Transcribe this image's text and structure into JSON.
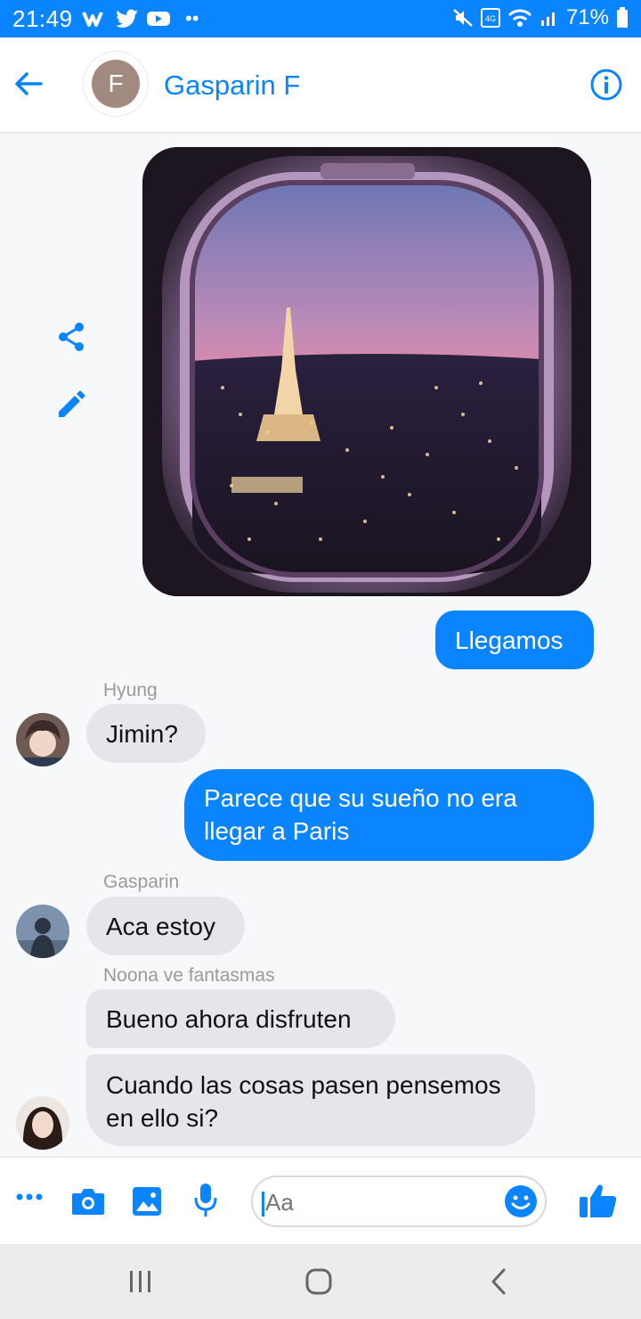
{
  "status": {
    "time": "21:49",
    "battery": "71%",
    "colors": {
      "bar": "#0a84ff"
    }
  },
  "header": {
    "avatar_letter": "F",
    "contact_name": "Gasparin F"
  },
  "messages": [
    {
      "type": "image",
      "direction": "out",
      "content": "airplane-window-eiffel-tower-photo"
    },
    {
      "type": "text",
      "direction": "out",
      "text": "Llegamos"
    },
    {
      "type": "text",
      "direction": "in",
      "sender": "Hyung",
      "text": "Jimin?"
    },
    {
      "type": "text",
      "direction": "out",
      "text": "Parece que su sueño no era llegar a Paris"
    },
    {
      "type": "text",
      "direction": "in",
      "sender": "Gasparin",
      "text": "Aca estoy"
    },
    {
      "type": "text",
      "direction": "in",
      "sender": "Noona ve fantasmas",
      "text": "Bueno ahora disfruten"
    },
    {
      "type": "text",
      "direction": "in",
      "sender": "Noona ve fantasmas",
      "text": "Cuando las cosas pasen pensemos en ello si?"
    }
  ],
  "composer": {
    "placeholder": "Aa",
    "icons": [
      "more-icon",
      "camera-icon",
      "gallery-icon",
      "microphone-icon",
      "emoji-icon",
      "like-icon"
    ]
  },
  "colors": {
    "accent": "#0a84ff",
    "incoming_bubble": "#e4e6eb"
  }
}
